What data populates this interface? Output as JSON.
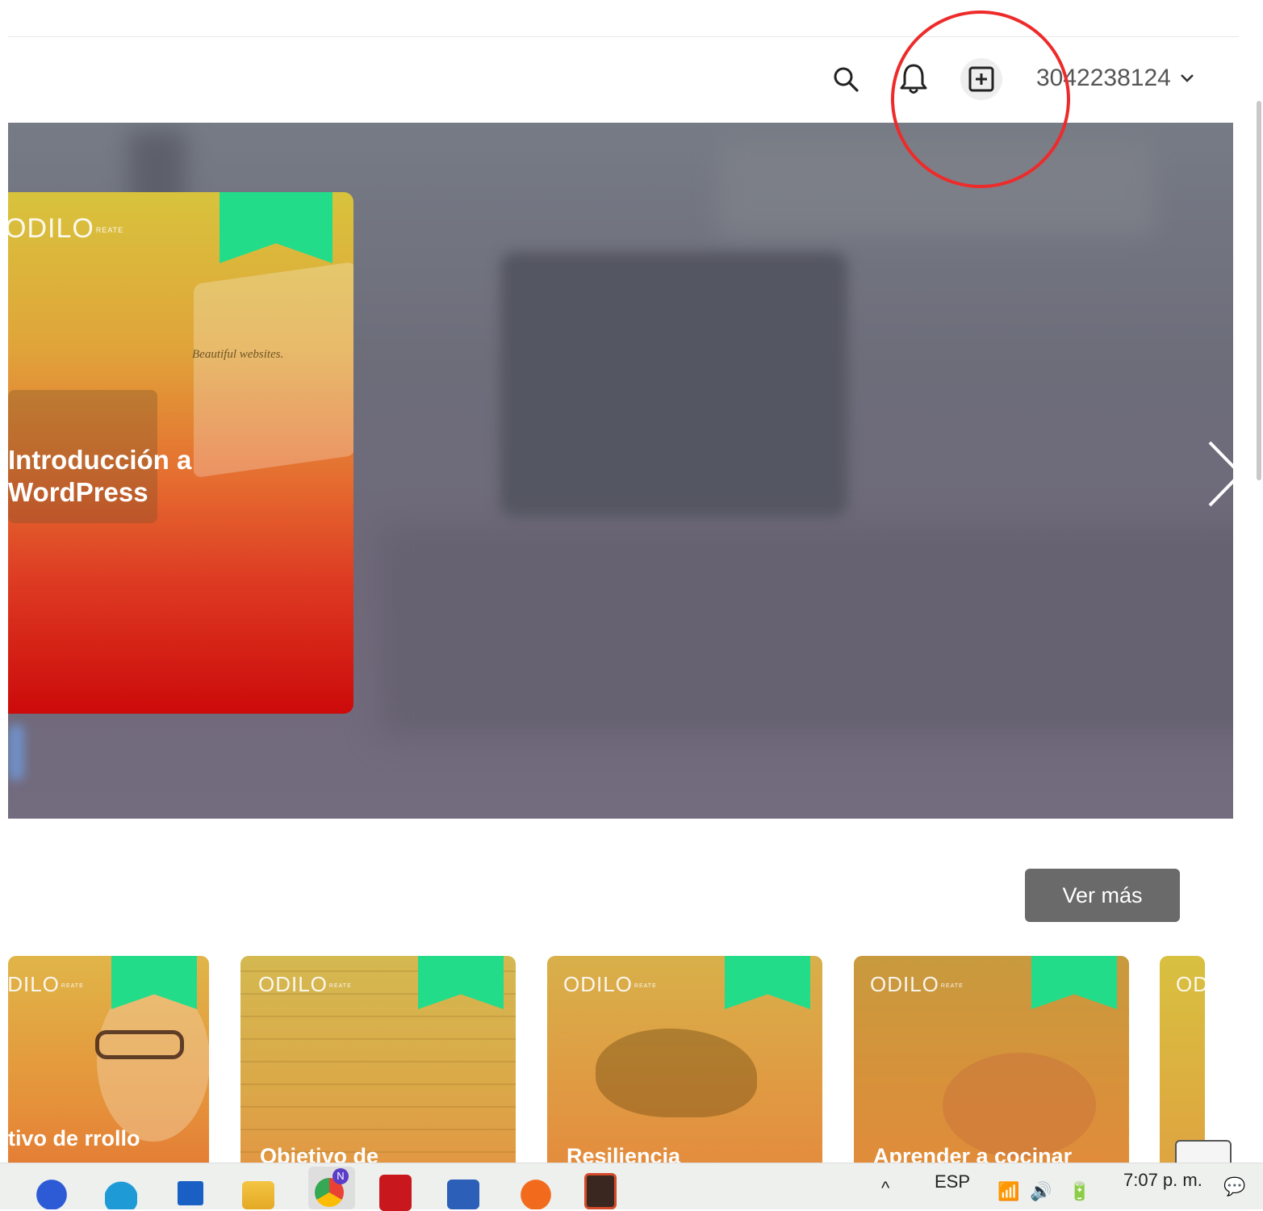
{
  "header": {
    "user_label": "3042238124",
    "icons": [
      "search-icon",
      "bell-icon",
      "add-box-icon",
      "chevron-down-icon"
    ]
  },
  "hero": {
    "card": {
      "logo": "ODILO",
      "logo_small": "REATE",
      "title_line1": "Introducción a",
      "title_line2": "WordPress",
      "screen_text": "Beautiful websites."
    },
    "next_icon": "chevron-right-icon"
  },
  "section": {
    "see_more_label": "Ver más"
  },
  "courses": [
    {
      "logo": "ODILO",
      "logo_small": "REATE",
      "title": "tivo de rrollo"
    },
    {
      "logo": "ODILO",
      "logo_small": "REATE",
      "title": "Objetivo de"
    },
    {
      "logo": "ODILO",
      "logo_small": "REATE",
      "title": "Resiliencia"
    },
    {
      "logo": "ODILO",
      "logo_small": "REATE",
      "title": "Aprender a cocinar"
    },
    {
      "logo": "OD",
      "logo_small": "",
      "title": ""
    }
  ],
  "taskbar": {
    "apps": [
      "zoom-icon",
      "edge-icon",
      "store-icon",
      "file-explorer-icon",
      "chrome-icon",
      "acrobat-icon",
      "word-icon",
      "avast-icon",
      "app-icon"
    ],
    "chrome_badge": "N",
    "chevron": "^",
    "language": "ESP",
    "time": "7:07 p. m."
  },
  "colors": {
    "accent_ribbon": "#22dc8a",
    "annotation_circle": "#ee2b2b",
    "see_more_bg": "#6a6a6a"
  }
}
